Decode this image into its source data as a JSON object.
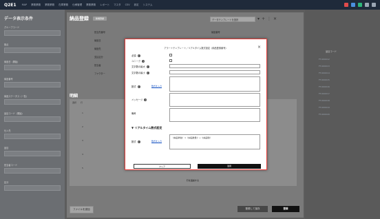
{
  "app": {
    "logo": "Q2E1",
    "nav": [
      "MAP",
      "業務業務",
      "業務業務",
      "在庫業務",
      "仕様管理",
      "業務業務",
      "レポート",
      "マスタ",
      "CSV",
      "設定",
      "システム"
    ]
  },
  "left": {
    "title": "データ表示条件",
    "fields": [
      {
        "label": "グループコード"
      },
      {
        "label": "拠点"
      },
      {
        "label": "納品日（開始）"
      },
      {
        "label": "納品番号"
      },
      {
        "label": "納品ステータス（一覧）"
      },
      {
        "label": "品目コード（開始）"
      },
      {
        "label": "仕入先"
      },
      {
        "label": "品目"
      },
      {
        "label": "担当者コード"
      },
      {
        "label": "区分"
      }
    ]
  },
  "main": {
    "title": "納品登録",
    "badge": "新規登録",
    "template_label": "データテンプレートを選択",
    "form_labels": [
      "担当先番号",
      "納品日",
      "納品先",
      "支払区分",
      "担当者",
      "ファクター"
    ],
    "form_labels_right": [
      "納品番号",
      "納品先名"
    ],
    "section": "明細",
    "columns": [
      "選択",
      "行"
    ],
    "rows": [
      "1",
      "2",
      "3",
      "4",
      "5"
    ],
    "add_row": "行を追加する",
    "file_button": "ファイルを追加",
    "draft_button": "登録して保存",
    "register_button": "登録"
  },
  "right": {
    "column": "品目コード",
    "rows": [
      "FT-000012",
      "FT-000013",
      "FT-000014",
      "FT-000015",
      "FT-000016",
      "FT-000017",
      "FT-000018",
      "FT-000019",
      "FT-000020"
    ]
  },
  "modal": {
    "title": "アラートテンプレート／リアルタイム数式設定（納品登録番号）",
    "fields": [
      {
        "label": "必須"
      },
      {
        "label": "ユニーク"
      },
      {
        "label": "文字数の最大"
      },
      {
        "label": "文字数の最小"
      },
      {
        "label": "数式"
      },
      {
        "label": "メッセージ"
      },
      {
        "label": "備考"
      }
    ],
    "formula_link": "数式を入力",
    "realtime_section": "リアルタイム数式設定",
    "realtime_label": "数式",
    "realtime_link": "数式を入力",
    "realtime_text": "（[納品単価]）×（[納品数量]）+（[納品額]）",
    "clear_button": "クリア",
    "apply_button": "適用"
  }
}
